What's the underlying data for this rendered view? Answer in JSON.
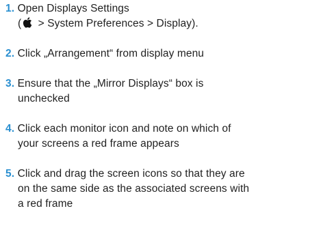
{
  "steps": [
    {
      "number": "1.",
      "lines": [
        "Open Displays Settings"
      ],
      "path": {
        "open_paren": "(",
        "apple_icon": "apple-logo-icon",
        "rest": " > System Preferences > Display)."
      }
    },
    {
      "number": "2.",
      "lines": [
        "Click „Arrangement“ from display menu"
      ]
    },
    {
      "number": "3.",
      "lines": [
        "Ensure that the „Mirror Displays“ box is",
        "unchecked"
      ]
    },
    {
      "number": "4.",
      "lines": [
        "Click each monitor icon and note on which of",
        "your screens a red frame appears"
      ]
    },
    {
      "number": "5.",
      "lines": [
        "Click and drag the screen icons so that they are",
        "on the same side as the associated screens with",
        "a red frame"
      ]
    }
  ],
  "colors": {
    "accent": "#2a8fd0",
    "text": "#1f1f1f"
  }
}
